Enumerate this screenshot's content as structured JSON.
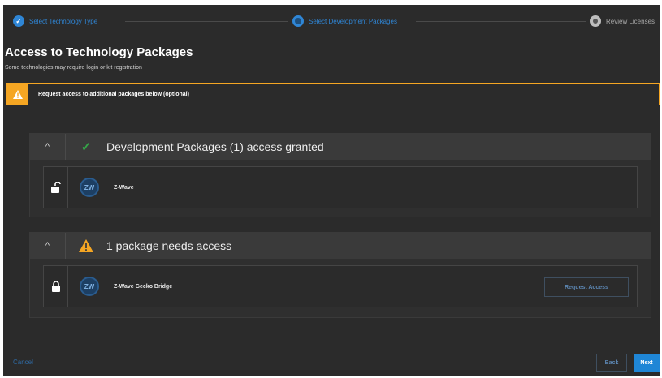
{
  "stepper": {
    "steps": [
      {
        "label": "Select Technology Type",
        "state": "done"
      },
      {
        "label": "Select Development Packages",
        "state": "active"
      },
      {
        "label": "Review Licenses",
        "state": "pending"
      }
    ]
  },
  "page": {
    "title": "Access to Technology Packages",
    "subtitle": "Some technologies may require login or kit registration"
  },
  "alert": {
    "text": "Request access to additional packages below (optional)",
    "icon": "warning-icon"
  },
  "sections": [
    {
      "title": "Development Packages (1) access granted",
      "status_icon": "check-icon",
      "collapse_glyph": "^",
      "packages": [
        {
          "name": "Z-Wave",
          "lock_icon": "unlocked-icon",
          "icon_text": "ZW"
        }
      ]
    },
    {
      "title": "1 package needs access",
      "status_icon": "warning-icon",
      "collapse_glyph": "^",
      "packages": [
        {
          "name": "Z-Wave Gecko Bridge",
          "lock_icon": "locked-icon",
          "icon_text": "ZW",
          "action_label": "Request Access"
        }
      ]
    }
  ],
  "footer": {
    "cancel_label": "Cancel",
    "back_label": "Back",
    "next_label": "Next"
  },
  "colors": {
    "accent": "#1f86d6",
    "warning": "#f5a623",
    "success": "#35a548",
    "background": "#2b2b2b"
  }
}
